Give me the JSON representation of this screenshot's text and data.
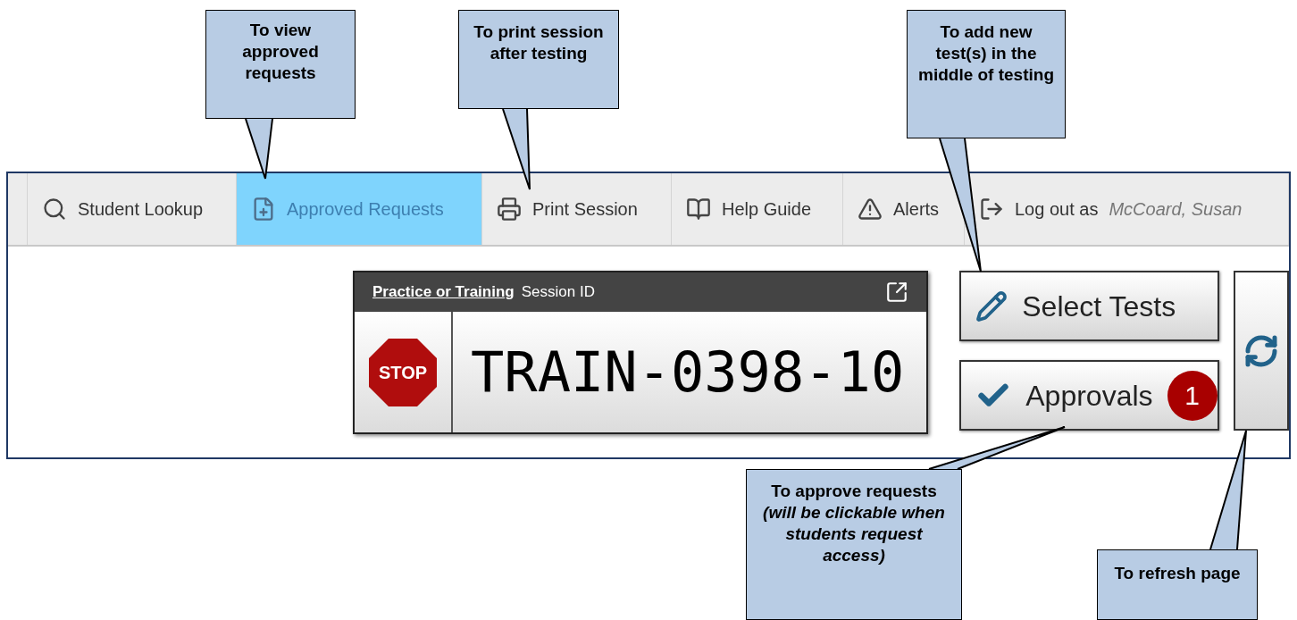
{
  "callouts": [
    {
      "text": "To view approved requests"
    },
    {
      "text": "To print session after testing"
    },
    {
      "text": "To add new test(s) in the middle of testing"
    },
    {
      "text": "To approve requests *(will be clickable when students request access)*"
    },
    {
      "text": "To refresh page"
    }
  ],
  "toolbar": {
    "items": [
      {
        "label": "Student Lookup",
        "selected": false
      },
      {
        "label": "Approved Requests",
        "selected": true
      },
      {
        "label": "Print Session",
        "selected": false
      },
      {
        "label": "Help Guide",
        "selected": false
      },
      {
        "label": "Alerts",
        "selected": false
      },
      {
        "label": "Log out as",
        "user": "McCoard, Susan",
        "selected": false
      }
    ]
  },
  "session": {
    "link": "Practice or Training",
    "label": "Session ID",
    "stop_sign": "STOP",
    "id": "TRAIN-0398-10"
  },
  "buttons": [
    {
      "label": "Select Tests"
    },
    {
      "label": "Approvals",
      "badge": "1"
    }
  ]
}
